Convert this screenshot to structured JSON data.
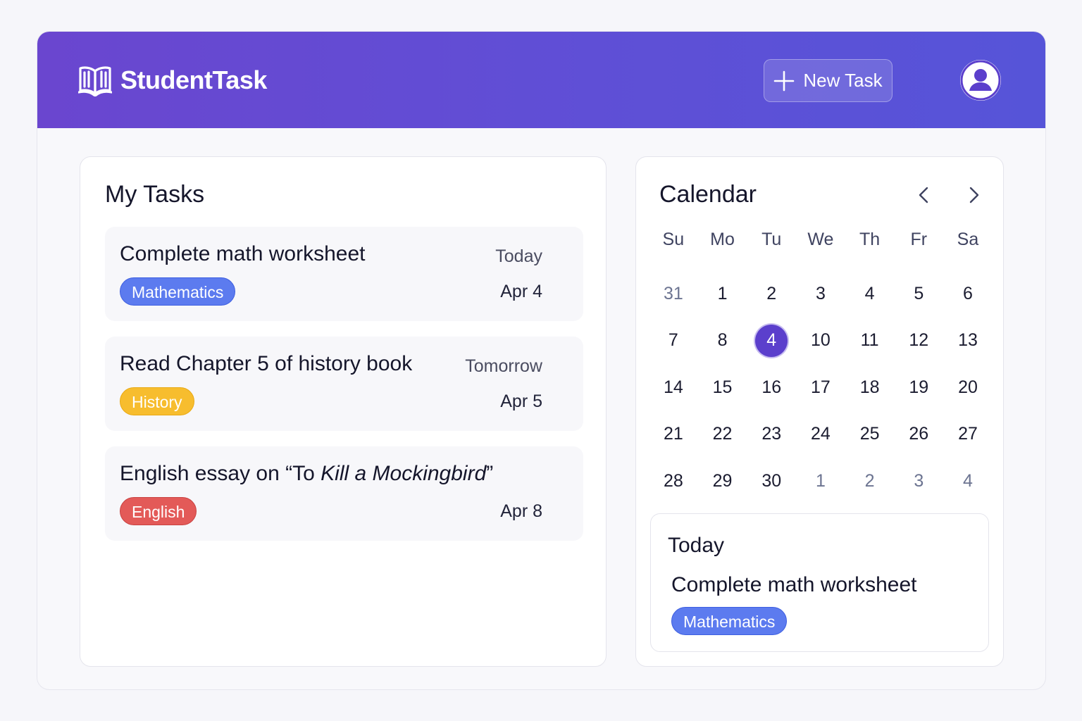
{
  "app": {
    "name": "StudentTask",
    "logo_icon": "open-book-icon",
    "accent_color": "#6a46cf"
  },
  "header": {
    "new_task_label": "New Task",
    "new_task_icon": "plus-icon",
    "avatar_icon": "user-avatar-icon"
  },
  "tasks": {
    "title": "My Tasks",
    "items": [
      {
        "title": "Complete math worksheet",
        "when": "Today",
        "date": "Apr 4",
        "tag": "Mathematics",
        "tag_color": "#5c7bef"
      },
      {
        "title": "Read Chapter 5 of history book",
        "when": "Tomorrow",
        "date": "Apr 5",
        "tag": "History",
        "tag_color": "#f7bd2e"
      },
      {
        "title_prefix": "English essay on “To ",
        "title_italic": "Kill a Mockingbird",
        "title_suffix": "”",
        "when": "",
        "date": "Apr 8",
        "tag": "English",
        "tag_color": "#e35a58"
      }
    ]
  },
  "calendar": {
    "title": "Calendar",
    "prev_icon": "chevron-left-icon",
    "next_icon": "chevron-right-icon",
    "weekdays": [
      "Su",
      "Mo",
      "Tu",
      "We",
      "Th",
      "Fr",
      "Sa"
    ],
    "weeks": [
      [
        "31",
        "1",
        "2",
        "3",
        "4",
        "5",
        "6"
      ],
      [
        "7",
        "8",
        "4",
        "10",
        "11",
        "12",
        "13"
      ],
      [
        "14",
        "15",
        "16",
        "17",
        "18",
        "19",
        "20"
      ],
      [
        "21",
        "22",
        "23",
        "24",
        "25",
        "26",
        "27"
      ],
      [
        "28",
        "29",
        "30",
        "1",
        "2",
        "3",
        "4"
      ]
    ],
    "selected_day": "4",
    "selected_color": "#5b3fcc",
    "today_section": {
      "label": "Today",
      "task_title": "Complete math worksheet",
      "tag": "Mathematics"
    }
  }
}
